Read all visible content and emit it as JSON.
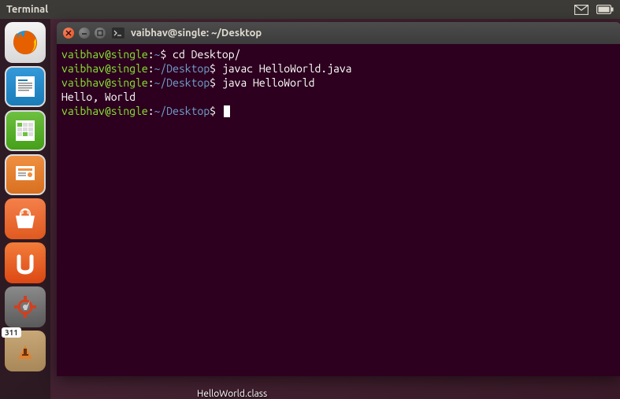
{
  "top_panel": {
    "title": "Terminal"
  },
  "launcher": {
    "badge_count": "311"
  },
  "window": {
    "title": "vaibhav@single: ~/Desktop"
  },
  "terminal": {
    "lines": [
      {
        "user": "vaibhav@single",
        "sep": ":",
        "path": "~",
        "dollar": "$ ",
        "cmd": "cd Desktop/"
      },
      {
        "user": "vaibhav@single",
        "sep": ":",
        "path": "~/Desktop",
        "dollar": "$ ",
        "cmd": "javac HelloWorld.java"
      },
      {
        "user": "vaibhav@single",
        "sep": ":",
        "path": "~/Desktop",
        "dollar": "$ ",
        "cmd": "java HelloWorld"
      }
    ],
    "output": "Hello, World",
    "last_prompt": {
      "user": "vaibhav@single",
      "sep": ":",
      "path": "~/Desktop",
      "dollar": "$ "
    }
  },
  "desktop": {
    "file_label": "HelloWorld.class"
  }
}
